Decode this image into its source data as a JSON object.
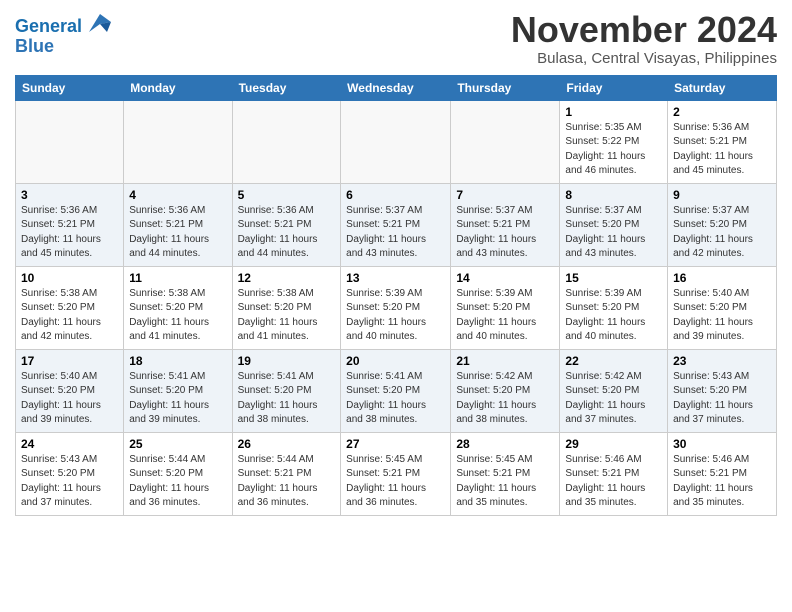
{
  "header": {
    "logo_line1": "General",
    "logo_line2": "Blue",
    "month": "November 2024",
    "location": "Bulasa, Central Visayas, Philippines"
  },
  "weekdays": [
    "Sunday",
    "Monday",
    "Tuesday",
    "Wednesday",
    "Thursday",
    "Friday",
    "Saturday"
  ],
  "weeks": [
    [
      {
        "day": "",
        "info": ""
      },
      {
        "day": "",
        "info": ""
      },
      {
        "day": "",
        "info": ""
      },
      {
        "day": "",
        "info": ""
      },
      {
        "day": "",
        "info": ""
      },
      {
        "day": "1",
        "info": "Sunrise: 5:35 AM\nSunset: 5:22 PM\nDaylight: 11 hours\nand 46 minutes."
      },
      {
        "day": "2",
        "info": "Sunrise: 5:36 AM\nSunset: 5:21 PM\nDaylight: 11 hours\nand 45 minutes."
      }
    ],
    [
      {
        "day": "3",
        "info": "Sunrise: 5:36 AM\nSunset: 5:21 PM\nDaylight: 11 hours\nand 45 minutes."
      },
      {
        "day": "4",
        "info": "Sunrise: 5:36 AM\nSunset: 5:21 PM\nDaylight: 11 hours\nand 44 minutes."
      },
      {
        "day": "5",
        "info": "Sunrise: 5:36 AM\nSunset: 5:21 PM\nDaylight: 11 hours\nand 44 minutes."
      },
      {
        "day": "6",
        "info": "Sunrise: 5:37 AM\nSunset: 5:21 PM\nDaylight: 11 hours\nand 43 minutes."
      },
      {
        "day": "7",
        "info": "Sunrise: 5:37 AM\nSunset: 5:21 PM\nDaylight: 11 hours\nand 43 minutes."
      },
      {
        "day": "8",
        "info": "Sunrise: 5:37 AM\nSunset: 5:20 PM\nDaylight: 11 hours\nand 43 minutes."
      },
      {
        "day": "9",
        "info": "Sunrise: 5:37 AM\nSunset: 5:20 PM\nDaylight: 11 hours\nand 42 minutes."
      }
    ],
    [
      {
        "day": "10",
        "info": "Sunrise: 5:38 AM\nSunset: 5:20 PM\nDaylight: 11 hours\nand 42 minutes."
      },
      {
        "day": "11",
        "info": "Sunrise: 5:38 AM\nSunset: 5:20 PM\nDaylight: 11 hours\nand 41 minutes."
      },
      {
        "day": "12",
        "info": "Sunrise: 5:38 AM\nSunset: 5:20 PM\nDaylight: 11 hours\nand 41 minutes."
      },
      {
        "day": "13",
        "info": "Sunrise: 5:39 AM\nSunset: 5:20 PM\nDaylight: 11 hours\nand 40 minutes."
      },
      {
        "day": "14",
        "info": "Sunrise: 5:39 AM\nSunset: 5:20 PM\nDaylight: 11 hours\nand 40 minutes."
      },
      {
        "day": "15",
        "info": "Sunrise: 5:39 AM\nSunset: 5:20 PM\nDaylight: 11 hours\nand 40 minutes."
      },
      {
        "day": "16",
        "info": "Sunrise: 5:40 AM\nSunset: 5:20 PM\nDaylight: 11 hours\nand 39 minutes."
      }
    ],
    [
      {
        "day": "17",
        "info": "Sunrise: 5:40 AM\nSunset: 5:20 PM\nDaylight: 11 hours\nand 39 minutes."
      },
      {
        "day": "18",
        "info": "Sunrise: 5:41 AM\nSunset: 5:20 PM\nDaylight: 11 hours\nand 39 minutes."
      },
      {
        "day": "19",
        "info": "Sunrise: 5:41 AM\nSunset: 5:20 PM\nDaylight: 11 hours\nand 38 minutes."
      },
      {
        "day": "20",
        "info": "Sunrise: 5:41 AM\nSunset: 5:20 PM\nDaylight: 11 hours\nand 38 minutes."
      },
      {
        "day": "21",
        "info": "Sunrise: 5:42 AM\nSunset: 5:20 PM\nDaylight: 11 hours\nand 38 minutes."
      },
      {
        "day": "22",
        "info": "Sunrise: 5:42 AM\nSunset: 5:20 PM\nDaylight: 11 hours\nand 37 minutes."
      },
      {
        "day": "23",
        "info": "Sunrise: 5:43 AM\nSunset: 5:20 PM\nDaylight: 11 hours\nand 37 minutes."
      }
    ],
    [
      {
        "day": "24",
        "info": "Sunrise: 5:43 AM\nSunset: 5:20 PM\nDaylight: 11 hours\nand 37 minutes."
      },
      {
        "day": "25",
        "info": "Sunrise: 5:44 AM\nSunset: 5:20 PM\nDaylight: 11 hours\nand 36 minutes."
      },
      {
        "day": "26",
        "info": "Sunrise: 5:44 AM\nSunset: 5:21 PM\nDaylight: 11 hours\nand 36 minutes."
      },
      {
        "day": "27",
        "info": "Sunrise: 5:45 AM\nSunset: 5:21 PM\nDaylight: 11 hours\nand 36 minutes."
      },
      {
        "day": "28",
        "info": "Sunrise: 5:45 AM\nSunset: 5:21 PM\nDaylight: 11 hours\nand 35 minutes."
      },
      {
        "day": "29",
        "info": "Sunrise: 5:46 AM\nSunset: 5:21 PM\nDaylight: 11 hours\nand 35 minutes."
      },
      {
        "day": "30",
        "info": "Sunrise: 5:46 AM\nSunset: 5:21 PM\nDaylight: 11 hours\nand 35 minutes."
      }
    ]
  ]
}
